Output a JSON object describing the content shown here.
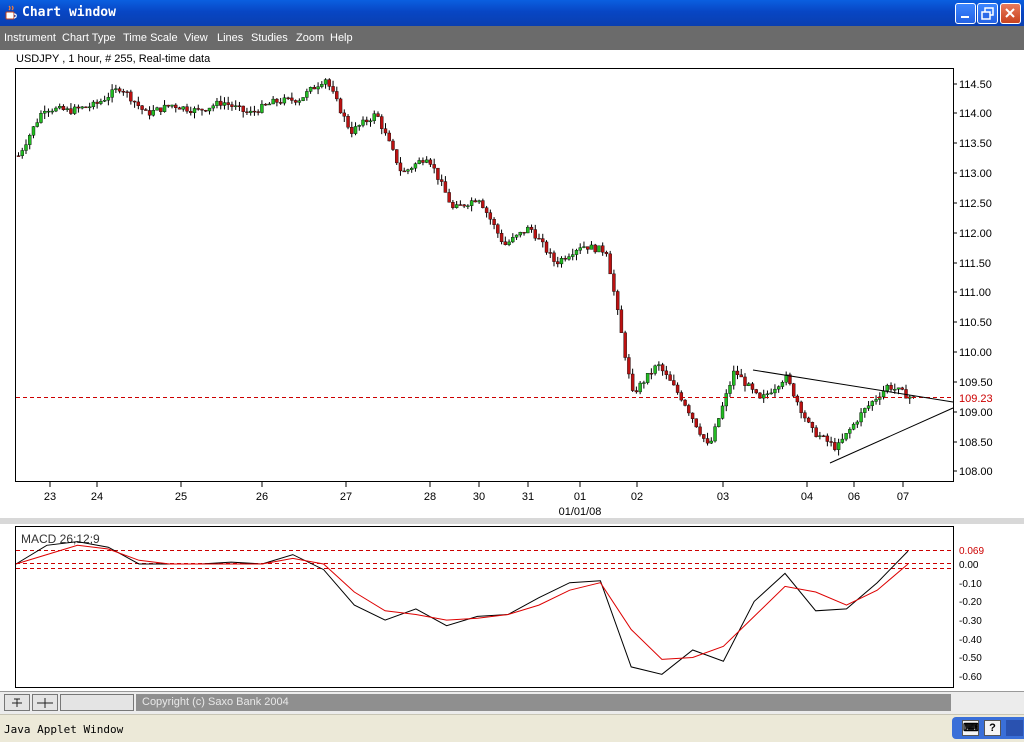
{
  "window": {
    "title": "Chart window"
  },
  "menu": [
    "Instrument",
    "Chart Type",
    "Time Scale",
    "View",
    "Lines",
    "Studies",
    "Zoom",
    "Help"
  ],
  "chart": {
    "info": "USDJPY , 1 hour, # 255, Real-time data",
    "price_ticks": [
      "114.50",
      "114.00",
      "113.50",
      "113.00",
      "112.50",
      "112.00",
      "111.50",
      "111.00",
      "110.50",
      "110.00",
      "109.50",
      "109.00",
      "108.50",
      "108.00"
    ],
    "current_price": "109.23",
    "date_labels": [
      "23",
      "24",
      "25",
      "26",
      "27",
      "28",
      "30",
      "31",
      "01",
      "02",
      "03",
      "04",
      "06",
      "07"
    ],
    "date_sublabel": "01/01/08",
    "colors": {
      "up": "#22bb22",
      "down": "#bb1111",
      "level": "#cc0000",
      "macd": "#000000",
      "signal": "#dd0000"
    }
  },
  "macd": {
    "label": "MACD 26;12;9",
    "ticks": [
      "0.069",
      "0.00",
      "-0.10",
      "-0.20",
      "-0.30",
      "-0.40",
      "-0.50",
      "-0.60"
    ]
  },
  "footer": {
    "copyright": "Copyright (c) Saxo Bank 2004"
  },
  "status": {
    "text": "Java Applet Window"
  },
  "chart_data": [
    {
      "type": "candlestick",
      "title": "USDJPY , 1 hour, # 255, Real-time data",
      "ylim": [
        107.9,
        114.7
      ],
      "x": [
        "23",
        "24",
        "25",
        "26",
        "27",
        "28",
        "30",
        "31",
        "01",
        "02",
        "03",
        "04",
        "06",
        "07"
      ],
      "approx_close_path": [
        113.3,
        114.1,
        114.05,
        114.15,
        114.45,
        114.0,
        114.15,
        114.05,
        114.2,
        114.0,
        114.2,
        114.25,
        114.6,
        113.7,
        114.0,
        113.0,
        113.3,
        112.4,
        112.6,
        111.8,
        112.1,
        111.5,
        111.8,
        111.7,
        109.3,
        109.8,
        109.2,
        108.4,
        109.7,
        109.2,
        109.6,
        108.7,
        108.4,
        109.0,
        109.45,
        109.23
      ],
      "current_level": 109.23
    },
    {
      "type": "line",
      "title": "MACD 26;12;9",
      "ylim": [
        -0.62,
        0.12
      ],
      "series": [
        {
          "name": "MACD",
          "values": [
            0.0,
            0.1,
            0.12,
            0.09,
            0.0,
            0.0,
            0.0,
            0.01,
            0.0,
            0.05,
            -0.03,
            -0.22,
            -0.3,
            -0.24,
            -0.33,
            -0.28,
            -0.27,
            -0.18,
            -0.1,
            -0.09,
            -0.55,
            -0.59,
            -0.46,
            -0.52,
            -0.2,
            -0.05,
            -0.25,
            -0.24,
            -0.1,
            0.069
          ]
        },
        {
          "name": "Signal",
          "values": [
            0.0,
            0.05,
            0.1,
            0.08,
            0.02,
            0.0,
            0.0,
            0.0,
            0.0,
            0.03,
            0.0,
            -0.15,
            -0.25,
            -0.27,
            -0.3,
            -0.29,
            -0.27,
            -0.22,
            -0.14,
            -0.1,
            -0.35,
            -0.51,
            -0.5,
            -0.44,
            -0.28,
            -0.12,
            -0.15,
            -0.22,
            -0.14,
            0.0
          ]
        }
      ]
    }
  ]
}
